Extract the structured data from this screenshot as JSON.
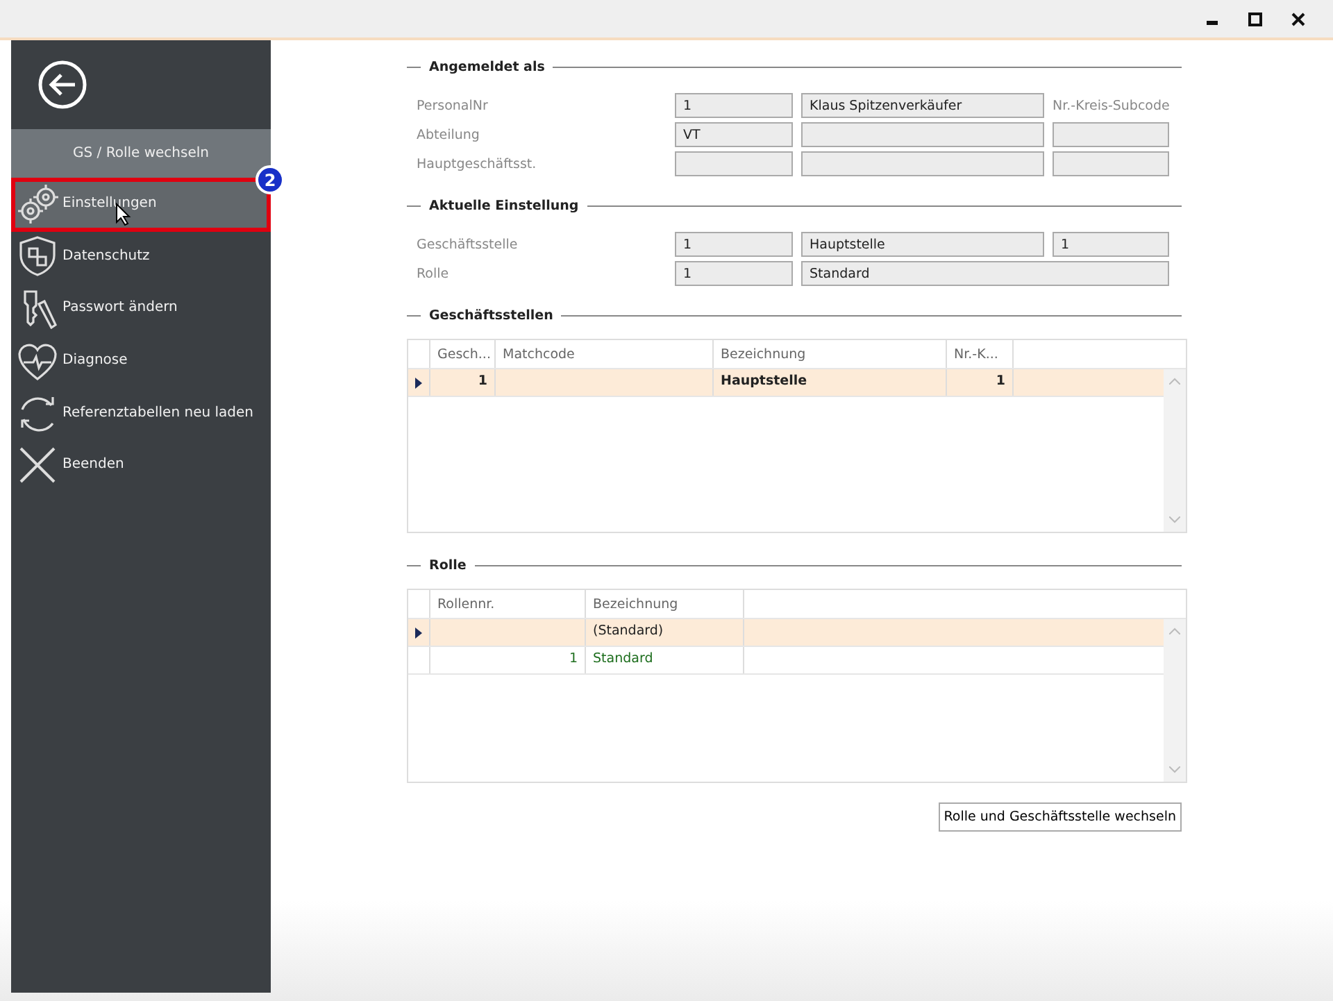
{
  "sidebar": {
    "header": "GS / Rolle wechseln",
    "items": [
      {
        "label": "Einstellungen",
        "selected": true,
        "annotation": "2"
      },
      {
        "label": "Datenschutz",
        "selected": false
      },
      {
        "label": "Passwort ändern",
        "selected": false
      },
      {
        "label": "Diagnose",
        "selected": false
      },
      {
        "label": "Referenztabellen neu laden",
        "selected": false
      },
      {
        "label": "Beenden",
        "selected": false
      }
    ]
  },
  "sections": [
    {
      "title": "Angemeldet als",
      "rows": [
        {
          "label": "PersonalNr",
          "fields": [
            "1",
            "Klaus Spitzenverkäufer"
          ],
          "extra_label": "Nr.-Kreis-Subcode"
        },
        {
          "label": "Abteilung",
          "fields": [
            "VT"
          ]
        },
        {
          "label": "Hauptgeschäftsst."
        }
      ]
    },
    {
      "title": "Aktuelle Einstellung",
      "rows": [
        {
          "label": "Geschäftsstelle",
          "fields": [
            "1",
            "Hauptstelle",
            "1"
          ]
        },
        {
          "label": "Rolle",
          "fields": [
            "1",
            "Standard"
          ],
          "wide": true
        }
      ]
    }
  ],
  "grids": [
    {
      "title": "Geschäftsstellen",
      "columns": [
        "Gesch...",
        "Matchcode",
        "Bezeichnung",
        "Nr.-K..."
      ],
      "bold": true,
      "rows": [
        {
          "cells": [
            "1",
            "",
            "Hauptstelle",
            "1"
          ],
          "selected": true
        }
      ]
    },
    {
      "title": "Rolle",
      "columns": [
        "Rollennr.",
        "Bezeichnung"
      ],
      "bold": false,
      "rows": [
        {
          "cells": [
            "",
            "(Standard)"
          ],
          "selected": true
        },
        {
          "cells": [
            "1",
            "Standard"
          ],
          "selected": false,
          "color": "#1e6e1e"
        }
      ]
    }
  ],
  "action_button": "Rolle und Geschäftsstelle wechseln"
}
